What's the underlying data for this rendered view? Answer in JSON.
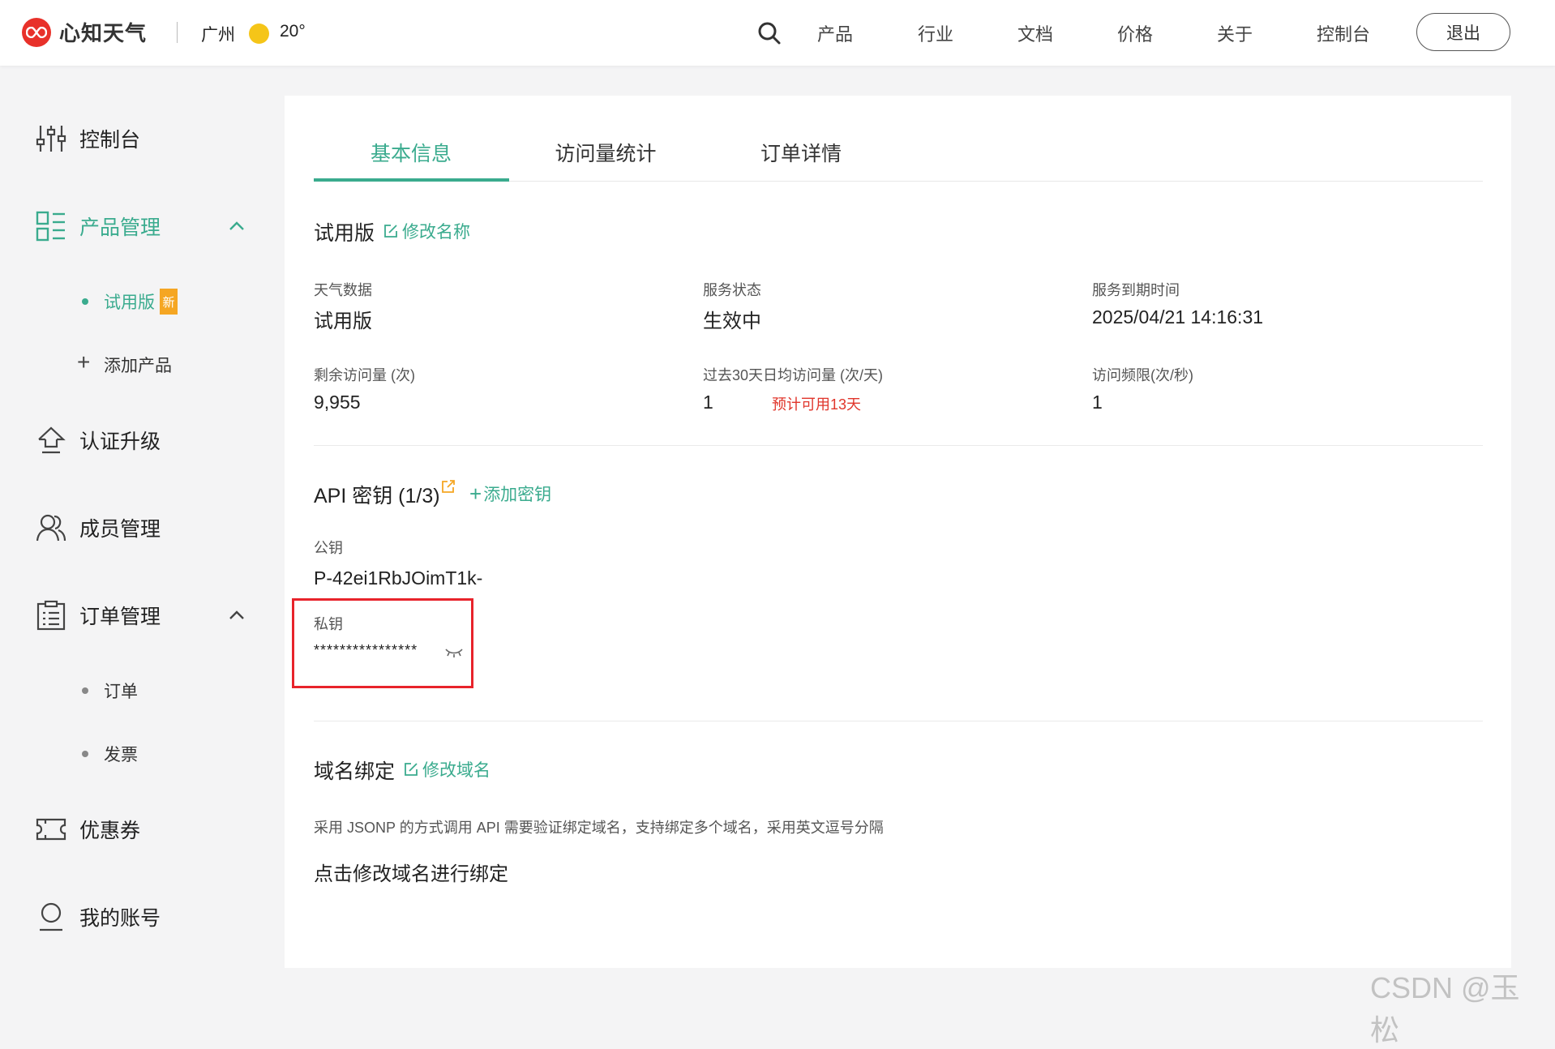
{
  "header": {
    "brand": "心知天气",
    "city": "广州",
    "temperature": "20°",
    "nav": [
      "产品",
      "行业",
      "文档",
      "价格",
      "关于",
      "控制台"
    ],
    "logout": "退出"
  },
  "sidebar": {
    "items": [
      {
        "label": "控制台",
        "icon": "sliders-icon"
      },
      {
        "label": "产品管理",
        "icon": "layout-grid-icon",
        "expanded": true
      },
      {
        "label": "认证升级",
        "icon": "upload-icon"
      },
      {
        "label": "成员管理",
        "icon": "users-icon"
      },
      {
        "label": "订单管理",
        "icon": "clipboard-list-icon",
        "expanded": true
      },
      {
        "label": "优惠券",
        "icon": "ticket-icon"
      },
      {
        "label": "我的账号",
        "icon": "user-icon"
      }
    ],
    "product_sub": {
      "trial": "试用版",
      "badge": "新",
      "add": "添加产品"
    },
    "order_sub": [
      "订单",
      "发票"
    ]
  },
  "tabs": [
    "基本信息",
    "访问量统计",
    "订单详情"
  ],
  "basic": {
    "plan_title": "试用版",
    "rename_link": "修改名称",
    "fields": [
      {
        "label": "天气数据",
        "value": "试用版"
      },
      {
        "label": "服务状态",
        "value": "生效中"
      },
      {
        "label": "服务到期时间",
        "value": "2025/04/21 14:16:31"
      },
      {
        "label": "剩余访问量 (次)",
        "value": "9,955"
      },
      {
        "label": "过去30天日均访问量 (次/天)",
        "value": "1",
        "note": "预计可用13天"
      },
      {
        "label": "访问频限(次/秒)",
        "value": "1"
      }
    ]
  },
  "api": {
    "title": "API 密钥 (1/3)",
    "add_key": "添加密钥",
    "public_label": "公钥",
    "public_value": "P-42ei1RbJOimT1k-",
    "private_label": "私钥",
    "private_value": "****************"
  },
  "domain": {
    "title": "域名绑定",
    "edit_link": "修改域名",
    "description": "采用 JSONP 的方式调用 API 需要验证绑定域名，支持绑定多个域名，采用英文逗号分隔",
    "hint": "点击修改域名进行绑定"
  },
  "watermark": "CSDN @玉 松",
  "colors": {
    "accent": "#3aab8e",
    "brand": "#e8312a",
    "warning": "#e0352b",
    "badge": "#f5a623",
    "highlight": "#e8232b"
  }
}
